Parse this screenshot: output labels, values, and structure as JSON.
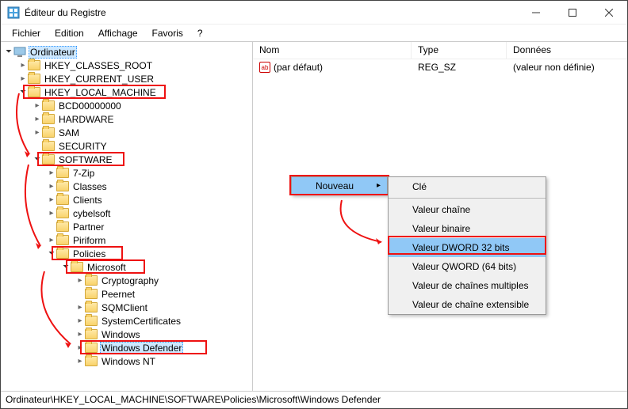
{
  "window": {
    "title": "Éditeur du Registre"
  },
  "menu": {
    "file": "Fichier",
    "edit": "Edition",
    "view": "Affichage",
    "fav": "Favoris",
    "help": "?"
  },
  "tree": {
    "root": "Ordinateur",
    "hkcr": "HKEY_CLASSES_ROOT",
    "hkcu": "HKEY_CURRENT_USER",
    "hklm": "HKEY_LOCAL_MACHINE",
    "bcd": "BCD00000000",
    "hw": "HARDWARE",
    "sam": "SAM",
    "sec": "SECURITY",
    "sw": "SOFTWARE",
    "zip": "7-Zip",
    "classes": "Classes",
    "clients": "Clients",
    "cybel": "cybelsoft",
    "partner": "Partner",
    "piri": "Piriform",
    "policies": "Policies",
    "ms": "Microsoft",
    "crypto": "Cryptography",
    "peer": "Peernet",
    "sqm": "SQMClient",
    "syscert": "SystemCertificates",
    "windows": "Windows",
    "wd": "Windows Defender",
    "winnt": "Windows NT"
  },
  "cols": {
    "name": "Nom",
    "type": "Type",
    "data": "Données"
  },
  "vals": {
    "default_name": "(par défaut)",
    "default_type": "REG_SZ",
    "default_data": "(valeur non définie)"
  },
  "ctx": {
    "new": "Nouveau"
  },
  "sub": {
    "key": "Clé",
    "string": "Valeur chaîne",
    "binary": "Valeur binaire",
    "dword": "Valeur DWORD 32 bits",
    "qword": "Valeur QWORD (64 bits)",
    "multi": "Valeur de chaînes multiples",
    "expand": "Valeur de chaîne extensible"
  },
  "status": {
    "path": "Ordinateur\\HKEY_LOCAL_MACHINE\\SOFTWARE\\Policies\\Microsoft\\Windows Defender"
  }
}
